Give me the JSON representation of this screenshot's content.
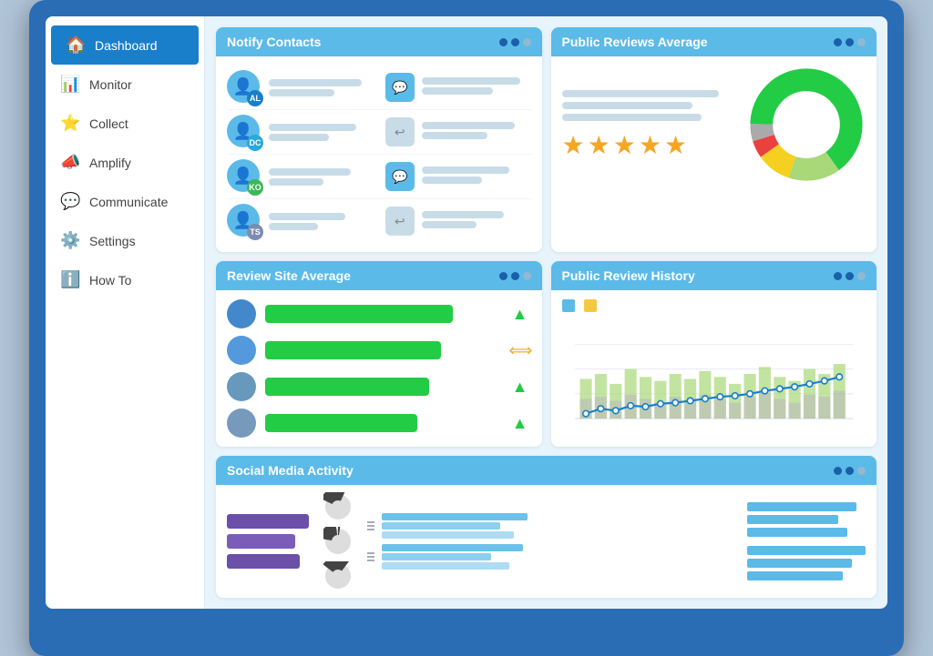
{
  "sidebar": {
    "items": [
      {
        "label": "Dashboard",
        "icon": "🏠",
        "active": true
      },
      {
        "label": "Monitor",
        "icon": "📊",
        "active": false
      },
      {
        "label": "Collect",
        "icon": "⭐",
        "active": false
      },
      {
        "label": "Amplify",
        "icon": "📣",
        "active": false
      },
      {
        "label": "Communicate",
        "icon": "💬",
        "active": false
      },
      {
        "label": "Settings",
        "icon": "⚙️",
        "active": false
      },
      {
        "label": "How To",
        "icon": "ℹ️",
        "active": false
      }
    ]
  },
  "notifyContacts": {
    "title": "Notify Contacts",
    "contacts": [
      {
        "badge": "AL",
        "badgeClass": "badge-al",
        "hasChat": true
      },
      {
        "badge": "DC",
        "badgeClass": "badge-dc",
        "hasChat": false
      },
      {
        "badge": "KO",
        "badgeClass": "badge-ko",
        "hasChat": true
      },
      {
        "badge": "TS",
        "badgeClass": "badge-ts",
        "hasChat": false
      }
    ]
  },
  "publicReviewsAverage": {
    "title": "Public Reviews Average",
    "stars": 4.5,
    "donut": {
      "segments": [
        {
          "color": "#22cc44",
          "value": 65
        },
        {
          "color": "#a8d878",
          "value": 15
        },
        {
          "color": "#f5d020",
          "value": 10
        },
        {
          "color": "#e8413e",
          "value": 5
        },
        {
          "color": "#888",
          "value": 5
        }
      ]
    }
  },
  "reviewSiteAverage": {
    "title": "Review Site Average",
    "rows": [
      {
        "circleColor": "#4488cc",
        "barWidth": "80%",
        "trend": "up"
      },
      {
        "circleColor": "#5599dd",
        "barWidth": "75%",
        "trend": "rl"
      },
      {
        "circleColor": "#6699bb",
        "barWidth": "70%",
        "trend": "up"
      },
      {
        "circleColor": "#7799bb",
        "barWidth": "65%",
        "trend": "up"
      }
    ]
  },
  "publicReviewHistory": {
    "title": "Public Review History",
    "legend": [
      {
        "color": "#5bbae8",
        "label": ""
      },
      {
        "color": "#f5c842",
        "label": ""
      }
    ]
  },
  "socialMediaActivity": {
    "title": "Social Media Activity"
  }
}
